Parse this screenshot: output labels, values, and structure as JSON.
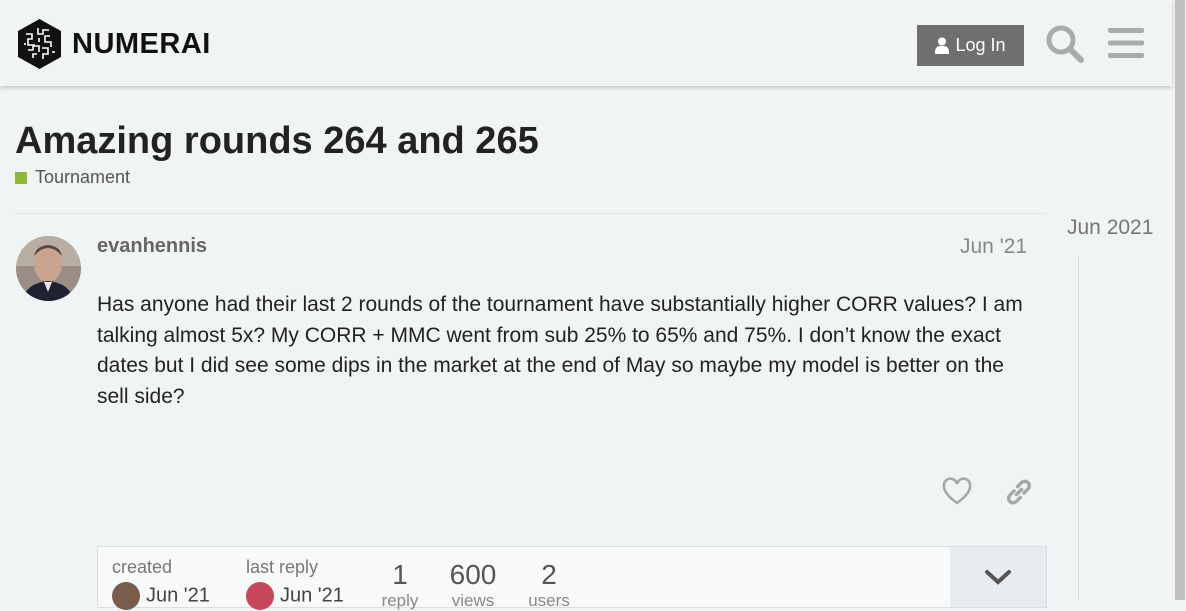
{
  "header": {
    "brand": "NUMERAI",
    "login_label": "Log In"
  },
  "topic": {
    "title": "Amazing rounds 264 and 265",
    "category": "Tournament",
    "category_color": "#8cb832"
  },
  "timeline": {
    "date": "Jun 2021"
  },
  "post": {
    "username": "evanhennis",
    "date": "Jun '21",
    "body": "Has anyone had their last 2 rounds of the tournament have substantially higher CORR values? I am talking almost 5x? My CORR + MMC went from sub 25% to 65% and 75%. I don’t know the exact dates but I did see some dips in the market at the end of May so maybe my model is better on the sell side?"
  },
  "topic_map": {
    "created_label": "created",
    "created_date": "Jun '21",
    "last_reply_label": "last reply",
    "last_reply_date": "Jun '21",
    "replies": "1",
    "replies_label": "reply",
    "views": "600",
    "views_label": "views",
    "users": "2",
    "users_label": "users"
  },
  "icons": {
    "login": "user-icon",
    "search": "search-icon",
    "menu": "hamburger-menu-icon",
    "like": "heart-icon",
    "share": "link-icon",
    "expand": "chevron-down-icon"
  }
}
